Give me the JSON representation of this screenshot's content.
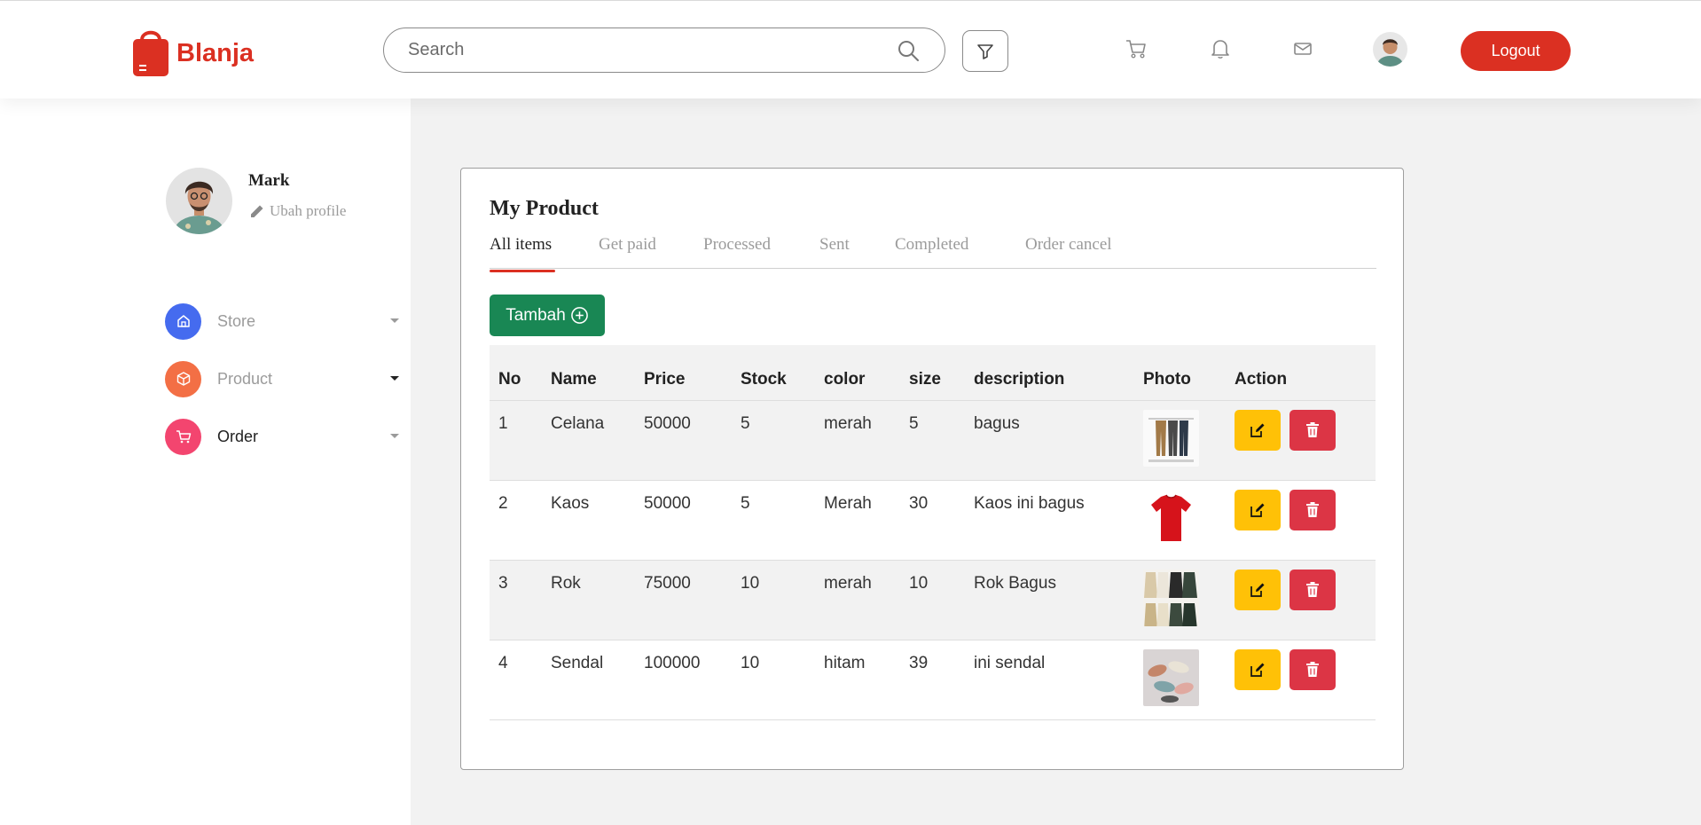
{
  "header": {
    "brand": "Blanja",
    "search_placeholder": "Search",
    "logout_label": "Logout",
    "brand_color": "#db3022"
  },
  "sidebar": {
    "profile": {
      "name": "Mark",
      "edit_label": "Ubah profile"
    },
    "items": [
      {
        "label": "Store",
        "icon": "home-icon",
        "color": "#456bef"
      },
      {
        "label": "Product",
        "icon": "package-icon",
        "color": "#f36f45"
      },
      {
        "label": "Order",
        "icon": "cart-icon",
        "color": "#f3456f"
      }
    ]
  },
  "main": {
    "title": "My Product",
    "tabs": [
      "All items",
      "Get paid",
      "Processed",
      "Sent",
      "Completed",
      "Order cancel"
    ],
    "active_tab": "All items",
    "add_label": "Tambah",
    "table": {
      "columns": [
        "No",
        "Name",
        "Price",
        "Stock",
        "color",
        "size",
        "description",
        "Photo",
        "Action"
      ],
      "rows": [
        {
          "no": "1",
          "name": "Celana",
          "price": "50000",
          "stock": "5",
          "color": "merah",
          "size": "5",
          "description": "bagus",
          "photo": "pants-photo"
        },
        {
          "no": "2",
          "name": "Kaos",
          "price": "50000",
          "stock": "5",
          "color": "Merah",
          "size": "30",
          "description": "Kaos ini bagus",
          "photo": "tshirt-photo"
        },
        {
          "no": "3",
          "name": "Rok",
          "price": "75000",
          "stock": "10",
          "color": "merah",
          "size": "10",
          "description": "Rok Bagus",
          "photo": "skirt-photo"
        },
        {
          "no": "4",
          "name": "Sendal",
          "price": "100000",
          "stock": "10",
          "color": "hitam",
          "size": "39",
          "description": "ini sendal",
          "photo": "sandal-photo"
        }
      ]
    }
  },
  "colors": {
    "accent": "#db3022",
    "add": "#198754",
    "edit": "#ffc107",
    "delete": "#dc3545"
  }
}
